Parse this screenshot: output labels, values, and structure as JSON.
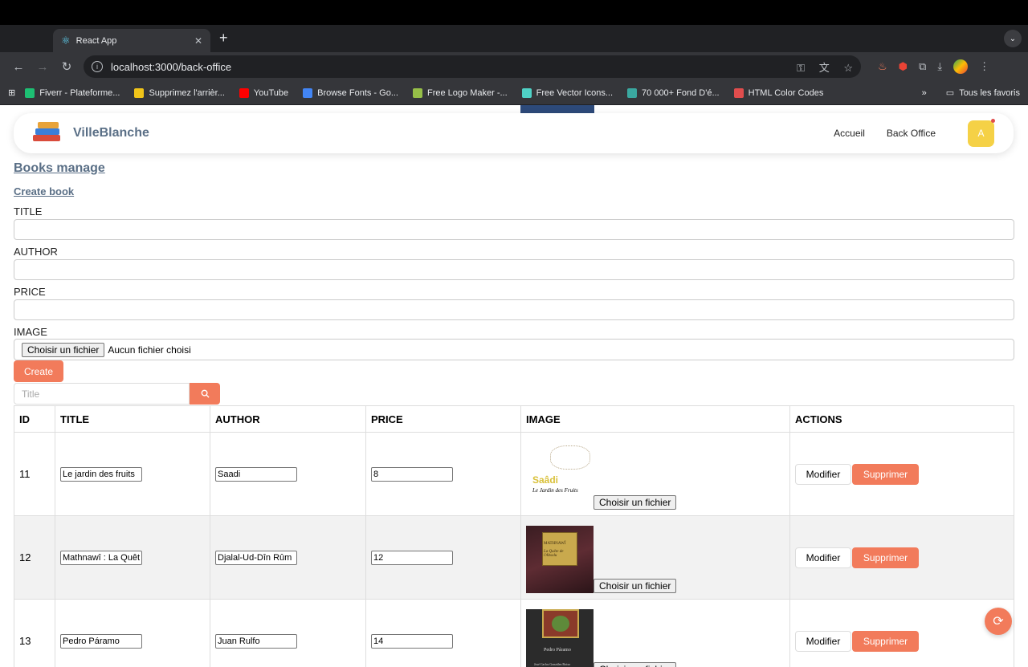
{
  "browser": {
    "tab_title": "React App",
    "url": "localhost:3000/back-office",
    "bookmarks": [
      {
        "label": "Fiverr - Plateforme...",
        "color": "#1dbf73"
      },
      {
        "label": "Supprimez l'arrièr...",
        "color": "#f0c419"
      },
      {
        "label": "YouTube",
        "color": "#ff0000"
      },
      {
        "label": "Browse Fonts - Go...",
        "color": "#4285f4"
      },
      {
        "label": "Free Logo Maker -...",
        "color": "#96bf48"
      },
      {
        "label": "Free Vector Icons...",
        "color": "#4fd1c5"
      },
      {
        "label": "70 000+ Fond D'é...",
        "color": "#3aa8a0"
      },
      {
        "label": "HTML Color Codes",
        "color": "#e04d4d"
      }
    ],
    "all_bookmarks": "Tous les favoris"
  },
  "header": {
    "brand": "VilleBlanche",
    "nav": [
      "Accueil",
      "Back Office"
    ],
    "avatar_letter": "A"
  },
  "main": {
    "title": "Books manage",
    "create_link": "Create book",
    "form": {
      "title_label": "TITLE",
      "author_label": "AUTHOR",
      "price_label": "PRICE",
      "image_label": "IMAGE",
      "file_button": "Choisir un fichier",
      "file_status": "Aucun fichier choisi",
      "create_button": "Create"
    },
    "search_placeholder": "Title",
    "table": {
      "headers": [
        "ID",
        "TITLE",
        "AUTHOR",
        "PRICE",
        "IMAGE",
        "ACTIONS"
      ],
      "rows": [
        {
          "id": "11",
          "title": "Le jardin des fruits",
          "author": "Saadi",
          "price": "8",
          "cover_text": "Saâdi",
          "cover_sub": "Le Jardin des Fruits"
        },
        {
          "id": "12",
          "title": "Mathnawî : La Quêt",
          "author": "Djalal-Ud-Dîn Rûm",
          "price": "12",
          "cover_text": "MATHNAWÎ",
          "cover_sub": "La Quête de l'Absolu"
        },
        {
          "id": "13",
          "title": "Pedro Páramo",
          "author": "Juan Rulfo",
          "price": "14",
          "cover_text": "Pedro Páramo",
          "cover_sub": "José Carlos González Boixo"
        }
      ],
      "file_button": "Choisir un fichier",
      "modify_button": "Modifier",
      "delete_button": "Supprimer"
    }
  },
  "colors": {
    "accent": "#f27b5b",
    "brand": "#5a6f86",
    "avatar": "#f5d146"
  }
}
